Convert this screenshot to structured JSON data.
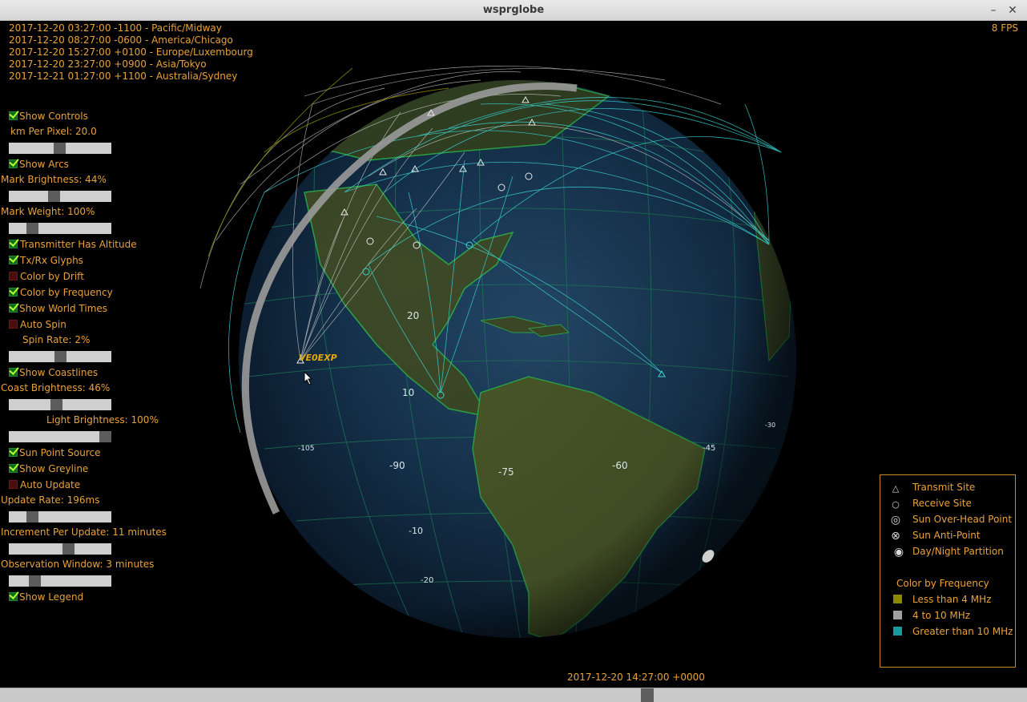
{
  "window": {
    "title": "wsprglobe"
  },
  "world_times": [
    "2017-12-20 03:27:00 -1100 - Pacific/Midway",
    "2017-12-20 08:27:00 -0600 - America/Chicago",
    "2017-12-20 15:27:00 +0100 - Europe/Luxembourg",
    "2017-12-20 23:27:00 +0900 - Asia/Tokyo",
    "2017-12-21 01:27:00 +1100 - Australia/Sydney"
  ],
  "fps": "8 FPS",
  "controls": {
    "show_controls": {
      "label": "Show Controls",
      "checked": true
    },
    "km_per_pixel": {
      "label": "km Per Pixel: 20.0",
      "value": 0.5
    },
    "show_arcs": {
      "label": "Show Arcs",
      "checked": true
    },
    "mark_brightness": {
      "label": "Mark Brightness: 44%",
      "value": 0.44
    },
    "mark_weight": {
      "label": "Mark Weight: 100%",
      "value": 0.2
    },
    "transmitter_has_altitude": {
      "label": "Transmitter Has Altitude",
      "checked": true
    },
    "tx_rx_glyphs": {
      "label": "Tx/Rx Glyphs",
      "checked": true
    },
    "color_by_drift": {
      "label": "Color by Drift",
      "checked": false
    },
    "color_by_frequency": {
      "label": "Color by Frequency",
      "checked": true
    },
    "show_world_times": {
      "label": "Show World Times",
      "checked": true
    },
    "auto_spin": {
      "label": "Auto Spin",
      "checked": false
    },
    "spin_rate": {
      "label": "Spin Rate: 2%",
      "value": 0.5
    },
    "show_coastlines": {
      "label": "Show Coastlines",
      "checked": true
    },
    "coast_brightness": {
      "label": "Coast Brightness: 46%",
      "value": 0.46
    },
    "light_brightness": {
      "label": "Light Brightness: 100%",
      "value": 1.0
    },
    "sun_point_source": {
      "label": "Sun Point Source",
      "checked": true
    },
    "show_greyline": {
      "label": "Show Greyline",
      "checked": true
    },
    "auto_update": {
      "label": "Auto Update",
      "checked": false
    },
    "update_rate": {
      "label": "Update Rate: 196ms",
      "value": 0.2
    },
    "increment_per_update": {
      "label": "Increment Per Update: 11 minutes",
      "value": 0.6
    },
    "observation_window": {
      "label": "Observation Window: 3 minutes",
      "value": 0.2
    },
    "show_legend": {
      "label": "Show Legend",
      "checked": true
    }
  },
  "legend": {
    "transmit_site": "Transmit Site",
    "receive_site": "Receive Site",
    "sun_overhead": "Sun Over-Head Point",
    "sun_antipoint": "Sun Anti-Point",
    "day_night": "Day/Night Partition",
    "color_heading": "Color by Frequency",
    "less_4": "Less than 4 MHz",
    "mid": "4 to 10 MHz",
    "greater_10": "Greater than 10 MHz",
    "colors": {
      "less_4": "#8a8a00",
      "mid": "#a0a0a0",
      "greater_10": "#1a9a9a"
    }
  },
  "globe": {
    "lon_labels": [
      "-105",
      "-90",
      "-75",
      "-60",
      "-45",
      "-30"
    ],
    "lat_labels": [
      "20",
      "10",
      "-10",
      "-20"
    ],
    "callsign": "VE0EXP"
  },
  "utc_time": "2017-12-20 14:27:00 +0000",
  "timeline": {
    "value": 0.63
  },
  "colors": {
    "ui_text": "#e8a23a",
    "arc_cyan": "#3ad6d6",
    "arc_white": "#dcdcdc"
  }
}
